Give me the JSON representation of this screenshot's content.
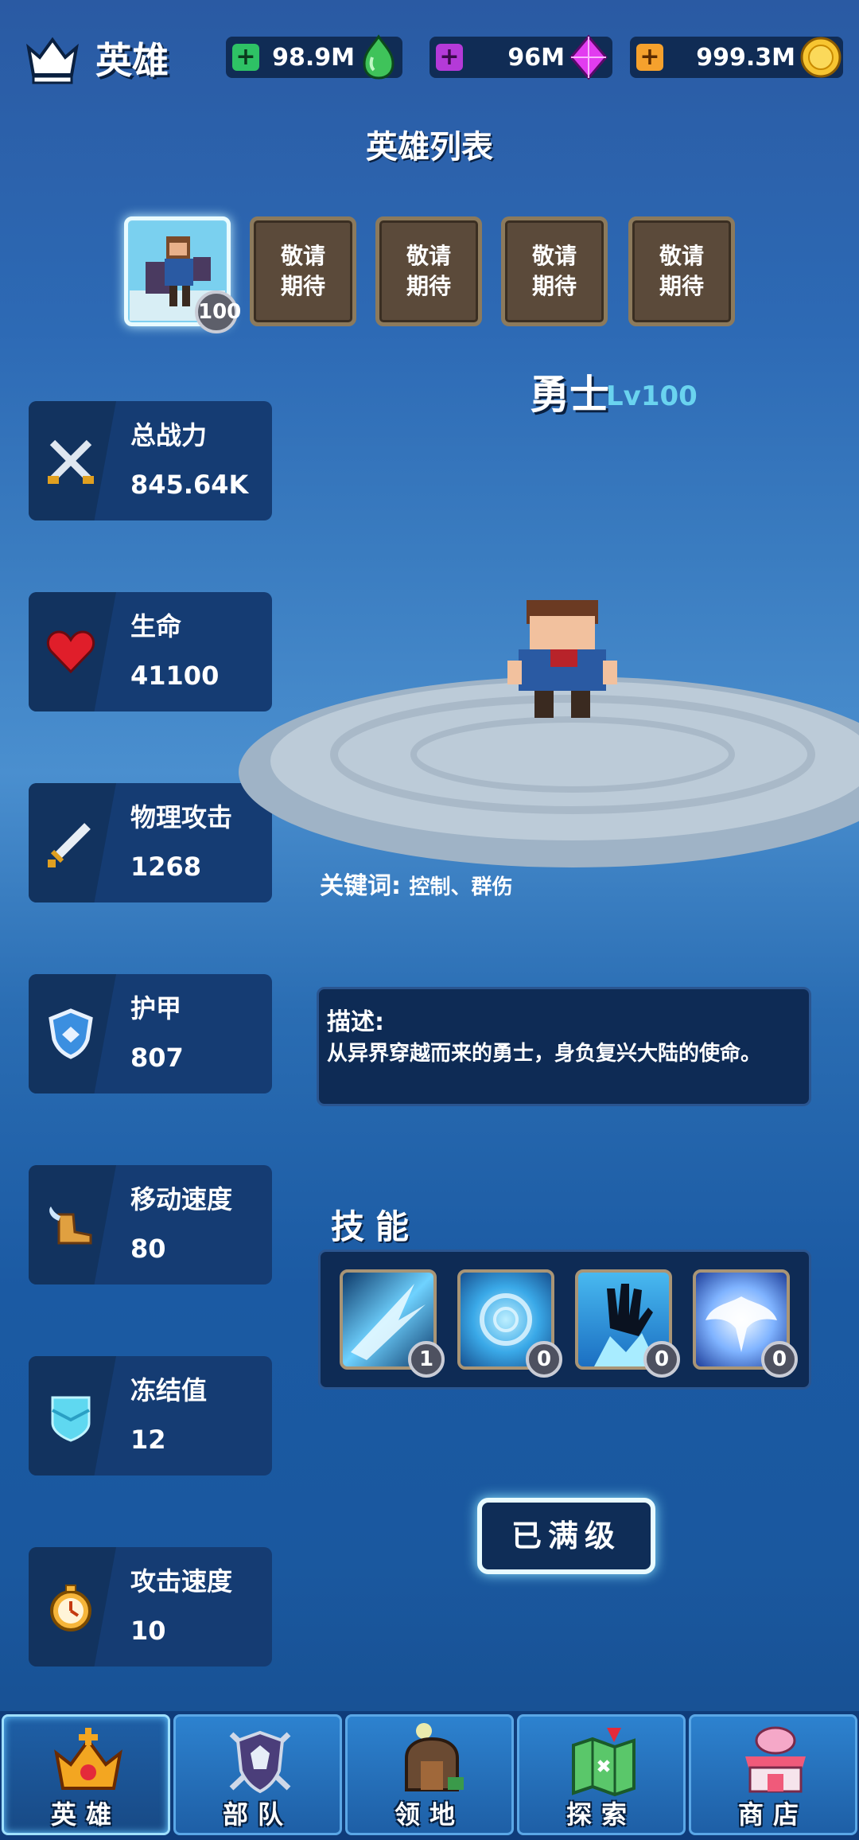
{
  "header": {
    "title": "英雄",
    "resources": [
      {
        "value": "98.9M",
        "icon": "green-gem-icon",
        "color": "#2ec265"
      },
      {
        "value": "96M",
        "icon": "purple-diamond-icon",
        "color": "#b43ad8"
      },
      {
        "value": "999.3M",
        "icon": "gold-coin-icon",
        "color": "#f5a12d"
      }
    ]
  },
  "hero_list": {
    "title": "英雄列表",
    "selected_level": "100",
    "locked_slots": [
      "敬请\n期待",
      "敬请\n期待",
      "敬请\n期待",
      "敬请\n期待"
    ]
  },
  "hero": {
    "name": "勇士",
    "level": "Lv100",
    "keywords_label": "关键词:",
    "keywords": "控制、群伤",
    "description_title": "描述:",
    "description": "从异界穿越而来的勇士，身负复兴大陆的使命。"
  },
  "stats": [
    {
      "label": "总战力",
      "value": "845.64K",
      "icon": "crossed-swords-icon"
    },
    {
      "label": "生命",
      "value": "41100",
      "icon": "heart-icon"
    },
    {
      "label": "物理攻击",
      "value": "1268",
      "icon": "sword-icon"
    },
    {
      "label": "护甲",
      "value": "807",
      "icon": "shield-icon"
    },
    {
      "label": "移动速度",
      "value": "80",
      "icon": "winged-boot-icon"
    },
    {
      "label": "冻结值",
      "value": "12",
      "icon": "ice-shield-icon"
    },
    {
      "label": "攻击速度",
      "value": "10",
      "icon": "stopwatch-icon"
    }
  ],
  "skills": {
    "title": "技能",
    "items": [
      {
        "level": "1",
        "icon": "ice-shards-skill-icon"
      },
      {
        "level": "0",
        "icon": "frost-vortex-skill-icon"
      },
      {
        "level": "0",
        "icon": "frozen-hand-skill-icon"
      },
      {
        "level": "0",
        "icon": "ice-phoenix-skill-icon"
      }
    ]
  },
  "max_button": "已满级",
  "nav": {
    "tabs": [
      {
        "label": "英雄",
        "icon": "crown-icon"
      },
      {
        "label": "部队",
        "icon": "wolf-shield-icon"
      },
      {
        "label": "领地",
        "icon": "house-door-icon"
      },
      {
        "label": "探索",
        "icon": "map-icon"
      },
      {
        "label": "商店",
        "icon": "shop-icon"
      }
    ]
  }
}
